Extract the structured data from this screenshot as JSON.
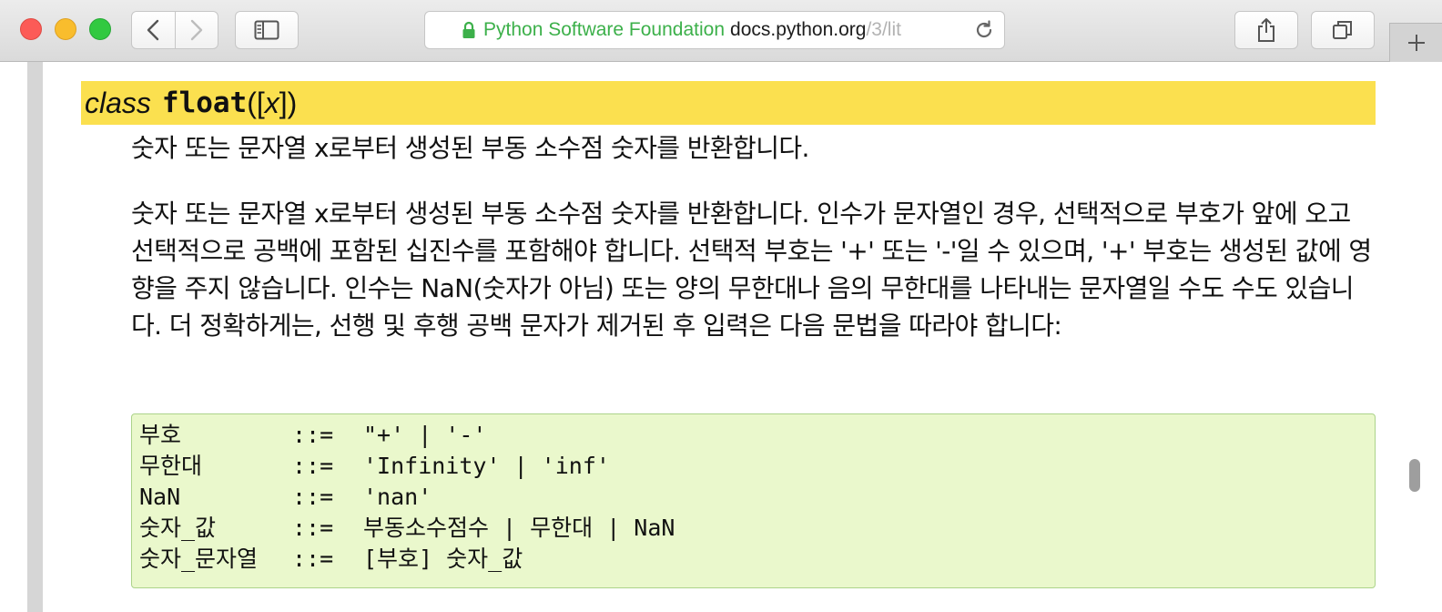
{
  "browser": {
    "address": {
      "organization": "Python Software Foundation",
      "domain": "docs.python.org",
      "path": "/3/lit"
    },
    "icons": {
      "back": "chevron-left-icon",
      "forward": "chevron-right-icon",
      "sidebar": "sidebar-icon",
      "lock": "lock-icon",
      "reload": "reload-icon",
      "share": "share-icon",
      "tabs": "tabs-icon",
      "new_tab": "plus-icon"
    }
  },
  "doc": {
    "signature": {
      "keyword": "class",
      "name": "float",
      "args_open": "([",
      "arg": "x",
      "args_close": "])"
    },
    "summary": "숫자 또는 문자열 x로부터 생성된 부동 소수점 숫자를 반환합니다.",
    "description": "숫자 또는 문자열 x로부터 생성된 부동 소수점 숫자를 반환합니다. 인수가 문자열인 경우, 선택적으로 부호가 앞에 오고 선택적으로 공백에 포함된 십진수를 포함해야 합니다. 선택적 부호는 '+' 또는 '-'일 수 있으며, '+' 부호는 생성된 값에 영향을 주지 않습니다. 인수는 NaN(숫자가 아님) 또는 양의 무한대나 음의 무한대를 나타내는 문자열일 수도 수도 있습니다. 더 정확하게는, 선행 및 후행 공백 문자가 제거된 후 입력은 다음 문법을 따라야 합니다:",
    "grammar": [
      {
        "name": "부호",
        "op": "::=",
        "rule": "\"+' | '-'"
      },
      {
        "name": "무한대",
        "op": "::=",
        "rule": "'Infinity' | 'inf'"
      },
      {
        "name": "NaN",
        "op": "::=",
        "rule": "'nan'"
      },
      {
        "name": "숫자_값",
        "op": "::=",
        "rule": "부동소수점수 | 무한대 | NaN"
      },
      {
        "name": "숫자_문자열",
        "op": "::=",
        "rule": "[부호] 숫자_값"
      }
    ]
  },
  "colors": {
    "signature_highlight": "#fbe04f",
    "code_background": "#eaf8cc",
    "code_border": "#acd38a",
    "secure_origin": "#3cb04a"
  }
}
